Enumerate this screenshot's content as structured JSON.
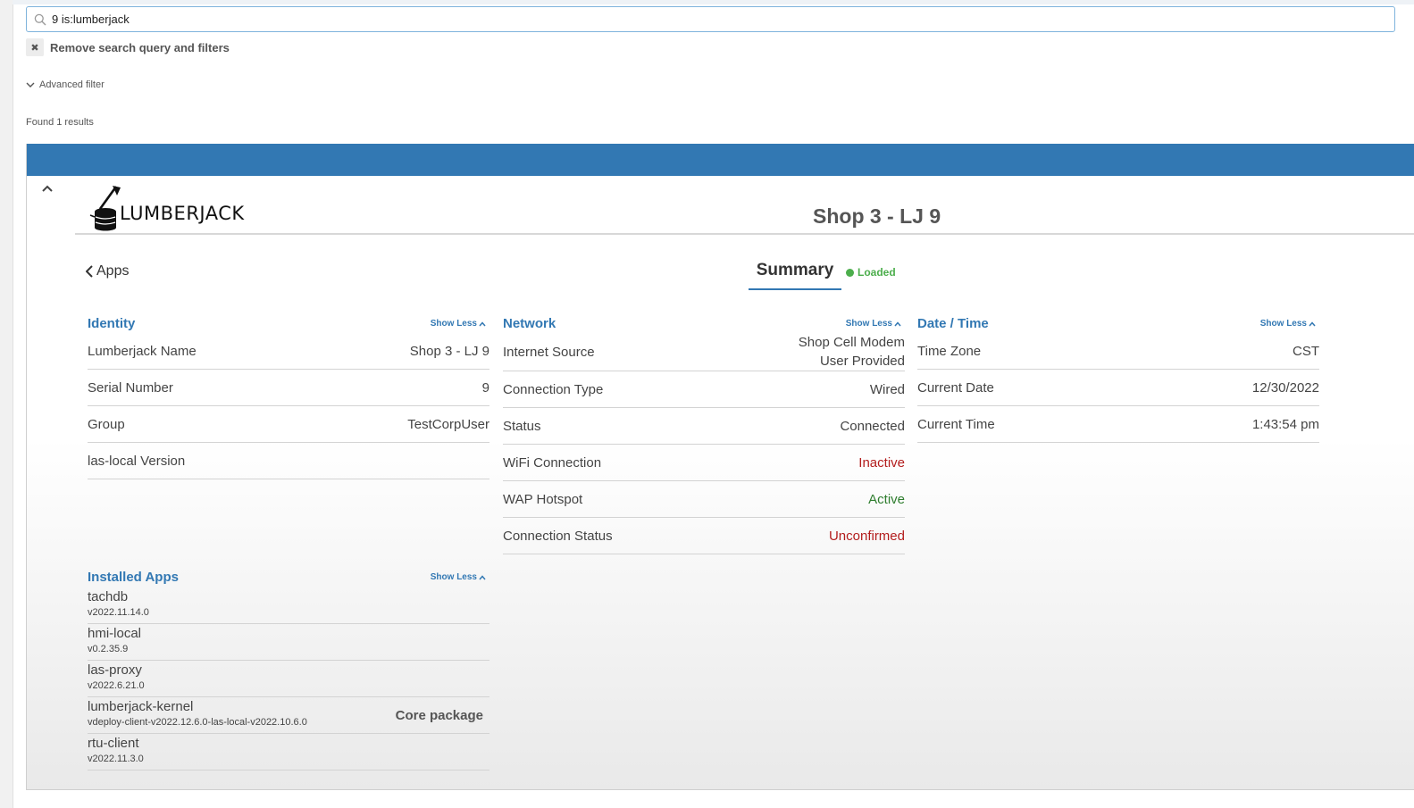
{
  "search": {
    "query": "9 is:lumberjack",
    "remove_label": "Remove search query and filters",
    "advanced_filter_label": "Advanced filter",
    "results_text": "Found 1 results"
  },
  "device": {
    "logo_text": "LUMBERJACK",
    "title": "Shop 3 - LJ 9"
  },
  "nav": {
    "apps_label": "Apps",
    "summary_tab": "Summary",
    "loaded_label": "Loaded"
  },
  "show_less_label": "Show Less",
  "identity": {
    "title": "Identity",
    "rows": [
      {
        "label": "Lumberjack Name",
        "value": "Shop 3 - LJ 9"
      },
      {
        "label": "Serial Number",
        "value": "9"
      },
      {
        "label": "Group",
        "value": "TestCorpUser"
      },
      {
        "label": "las-local Version",
        "value": ""
      }
    ]
  },
  "network": {
    "title": "Network",
    "rows": [
      {
        "label": "Internet Source",
        "value": "Shop Cell Modem",
        "value2": "User Provided"
      },
      {
        "label": "Connection Type",
        "value": "Wired"
      },
      {
        "label": "Status",
        "value": "Connected"
      },
      {
        "label": "WiFi Connection",
        "value": "Inactive",
        "status_color": "#b31d1d"
      },
      {
        "label": "WAP Hotspot",
        "value": "Active",
        "status_color": "#2e7d2e"
      },
      {
        "label": "Connection Status",
        "value": "Unconfirmed",
        "status_color": "#b31d1d"
      }
    ]
  },
  "datetime": {
    "title": "Date / Time",
    "rows": [
      {
        "label": "Time Zone",
        "value": "CST"
      },
      {
        "label": "Current Date",
        "value": "12/30/2022"
      },
      {
        "label": "Current Time",
        "value": "1:43:54 pm"
      }
    ]
  },
  "installed_apps": {
    "title": "Installed Apps",
    "items": [
      {
        "name": "tachdb",
        "version": "v2022.11.14.0",
        "tag": ""
      },
      {
        "name": "hmi-local",
        "version": "v0.2.35.9",
        "tag": ""
      },
      {
        "name": "las-proxy",
        "version": "v2022.6.21.0",
        "tag": ""
      },
      {
        "name": "lumberjack-kernel",
        "version": "vdeploy-client-v2022.12.6.0-las-local-v2022.10.6.0",
        "tag": "Core package"
      },
      {
        "name": "rtu-client",
        "version": "v2022.11.3.0",
        "tag": ""
      }
    ]
  },
  "colors": {
    "accent": "#3278b3",
    "loaded": "#4cae4c"
  }
}
